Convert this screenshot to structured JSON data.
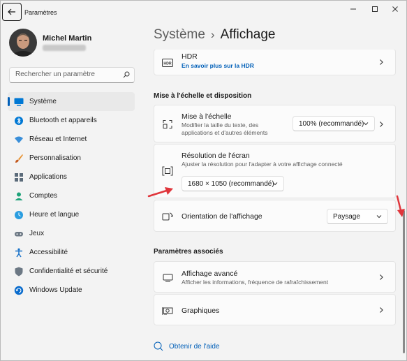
{
  "window": {
    "title": "Paramètres"
  },
  "icons": {
    "back": "arrow-left-icon",
    "minimize": "minimize-icon",
    "maximize": "maximize-icon",
    "close": "close-icon",
    "search": "search-icon",
    "chevron": "chevron-right-icon",
    "dropdown": "chevron-down-icon"
  },
  "user": {
    "name": "Michel Martin"
  },
  "search": {
    "placeholder": "Rechercher un paramètre"
  },
  "sidebar": {
    "items": [
      {
        "label": "Système",
        "icon": "monitor-icon",
        "active": true
      },
      {
        "label": "Bluetooth et appareils",
        "icon": "bluetooth-icon"
      },
      {
        "label": "Réseau et Internet",
        "icon": "wifi-icon"
      },
      {
        "label": "Personnalisation",
        "icon": "paintbrush-icon"
      },
      {
        "label": "Applications",
        "icon": "apps-icon"
      },
      {
        "label": "Comptes",
        "icon": "person-icon"
      },
      {
        "label": "Heure et langue",
        "icon": "globe-clock-icon"
      },
      {
        "label": "Jeux",
        "icon": "gamepad-icon"
      },
      {
        "label": "Accessibilité",
        "icon": "accessibility-icon"
      },
      {
        "label": "Confidentialité et sécurité",
        "icon": "shield-icon"
      },
      {
        "label": "Windows Update",
        "icon": "update-icon"
      }
    ]
  },
  "breadcrumb": {
    "parent": "Système",
    "separator": "›",
    "current": "Affichage"
  },
  "hdr": {
    "title": "HDR",
    "link": "En savoir plus sur la HDR",
    "icon": "hdr-icon"
  },
  "section_scale": {
    "heading": "Mise à l'échelle et disposition"
  },
  "scale": {
    "title": "Mise à l'échelle",
    "desc_line1": "Modifier la taille du texte, des",
    "desc_line2": "applications et d'autres éléments",
    "value": "100% (recommandé)",
    "icon": "scale-icon"
  },
  "resolution": {
    "title": "Résolution de l'écran",
    "desc": "Ajuster  la résolution pour l'adapter à votre  affichage connecté",
    "value": "1680 × 1050 (recommandé)",
    "icon": "resolution-icon"
  },
  "orientation": {
    "title": "Orientation de l'affichage",
    "value": "Paysage",
    "icon": "orientation-icon"
  },
  "section_related": {
    "heading": "Paramètres associés"
  },
  "advanced": {
    "title": "Affichage avancé",
    "desc": "Afficher les informations, fréquence de rafraîchissement",
    "icon": "monitor-icon"
  },
  "graphics": {
    "title": "Graphiques",
    "icon": "graphics-card-icon"
  },
  "help": {
    "label": "Obtenir de l'aide",
    "icon": "help-icon"
  },
  "colors": {
    "accent": "#005fb8",
    "annotation": "#e0353b"
  }
}
